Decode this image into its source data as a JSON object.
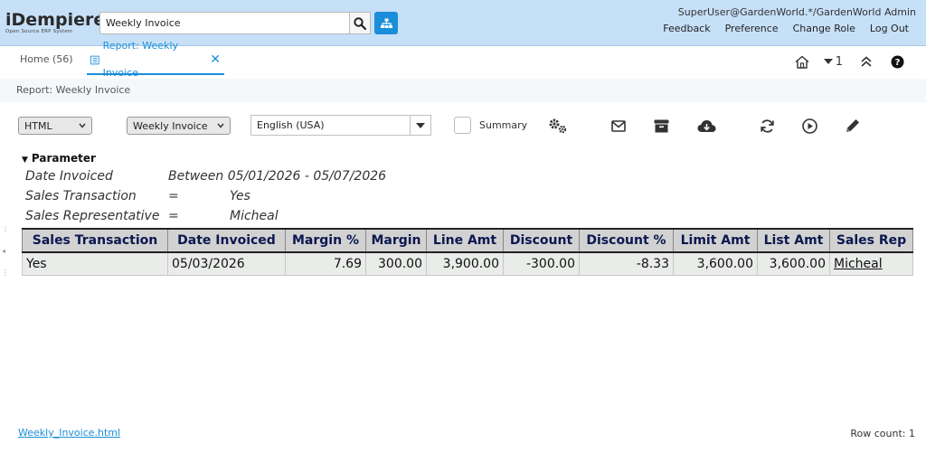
{
  "header": {
    "logo_main": "iDempiere",
    "logo_sub": "Open Source ERP System",
    "search_value": "Weekly Invoice",
    "user": "SuperUser@GardenWorld.*/GardenWorld Admin",
    "links": [
      "Feedback",
      "Preference",
      "Change Role",
      "Log Out"
    ]
  },
  "tabs": {
    "home": "Home (56)",
    "report": "Report: Weekly Invoice",
    "window_count": "1"
  },
  "breadcrumb": "Report: Weekly Invoice",
  "toolbar": {
    "format": "HTML",
    "report_view": "Weekly Invoice",
    "language": "English (USA)",
    "summary_label": "Summary",
    "summary_checked": false
  },
  "parameter": {
    "title": "Parameter",
    "rows": [
      {
        "name": "Date Invoiced",
        "op": "Between 05/01/2026 - 05/07/2026",
        "value": ""
      },
      {
        "name": "Sales Transaction",
        "op": "=",
        "value": "Yes"
      },
      {
        "name": "Sales Representative",
        "op": "=",
        "value": "Micheal"
      }
    ]
  },
  "table": {
    "headers": [
      "Sales Transaction",
      "Date Invoiced",
      "Margin %",
      "Margin",
      "Line Amt",
      "Discount",
      "Discount %",
      "Limit Amt",
      "List Amt",
      "Sales Rep"
    ],
    "rows": [
      [
        "Yes",
        "05/03/2026",
        "7.69",
        "300.00",
        "3,900.00",
        "-300.00",
        "-8.33",
        "3,600.00",
        "3,600.00",
        "Micheal"
      ]
    ]
  },
  "footer": {
    "file_link": "Weekly_Invoice.html",
    "row_count": "Row count: 1"
  },
  "colors": {
    "header_bg": "#c6e0f8",
    "accent": "#1a8ed8",
    "table_header_text": "#0b1850"
  }
}
